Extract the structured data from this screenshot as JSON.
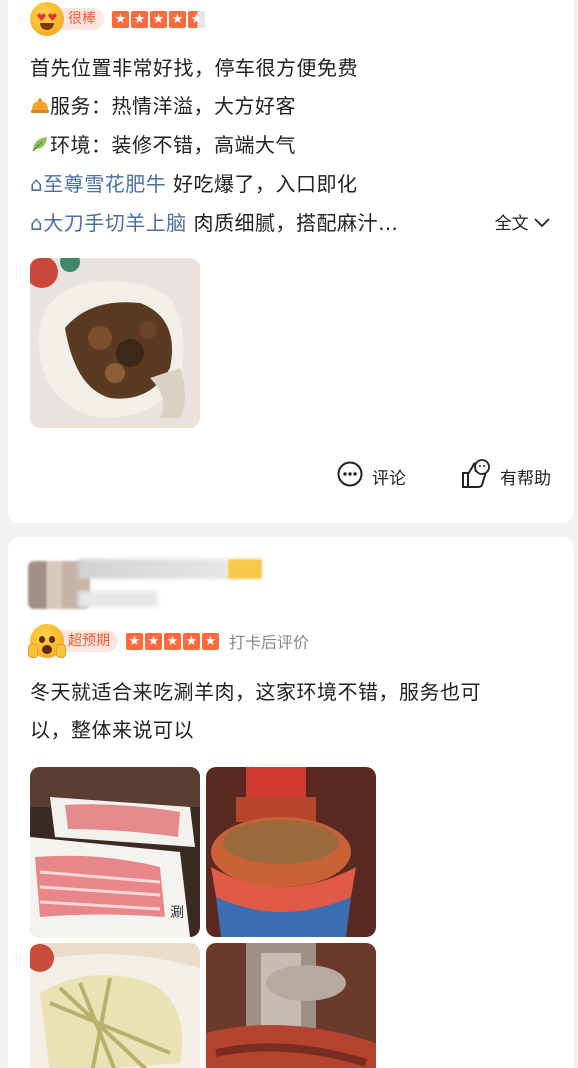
{
  "review1": {
    "badge": "很棒",
    "stars": 4.5,
    "lines": [
      {
        "icon": "",
        "text": "首先位置非常好找，停车很方便免费"
      },
      {
        "icon": "service-bell-icon",
        "label": "服务：",
        "text": "热情洋溢，大方好客"
      },
      {
        "icon": "leaf-icon",
        "label": "环境：",
        "text": "装修不错，高端大气"
      }
    ],
    "dishes": [
      {
        "name": "至尊雪花肥牛",
        "text": " 好吃爆了，入口即化"
      },
      {
        "name": "大刀手切羊上脑",
        "text": " 肉质细腻，搭配麻汁…"
      }
    ],
    "expand_label": "全文",
    "comment_label": "评论",
    "helpful_label": "有帮助"
  },
  "review2": {
    "badge": "超预期",
    "stars": 5,
    "checkin_label": "打卡后评价",
    "text_line1": "冬天就适合来吃涮羊肉，这家环境不错，服务也可",
    "text_line2": "以，整体来说可以"
  }
}
